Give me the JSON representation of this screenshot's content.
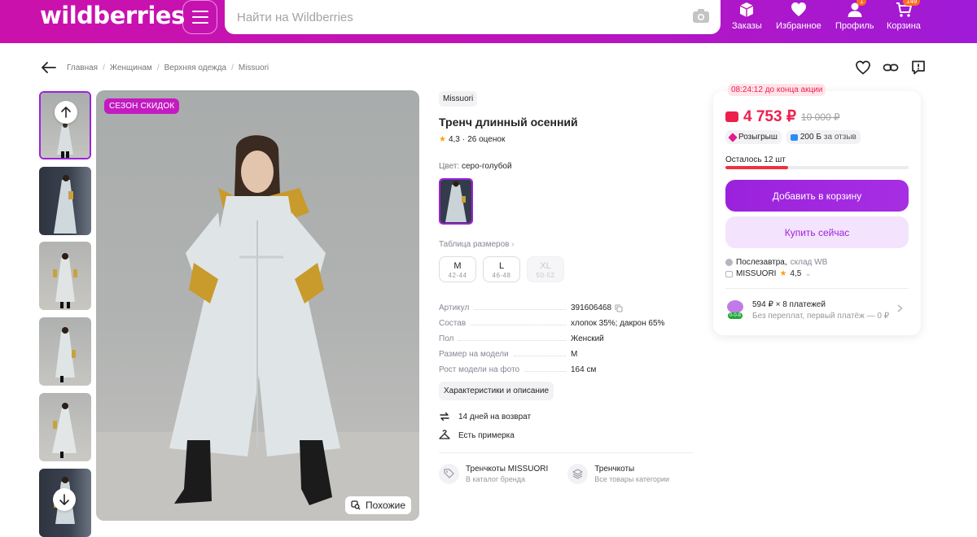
{
  "header": {
    "logo": "wildberries",
    "search_placeholder": "Найти на Wildberries",
    "nav": [
      {
        "label": "Заказы",
        "icon": "box-icon",
        "badge": ""
      },
      {
        "label": "Избранное",
        "icon": "heart-icon",
        "badge": ""
      },
      {
        "label": "Профиль",
        "icon": "user-icon",
        "badge": "1"
      },
      {
        "label": "Корзина",
        "icon": "cart-icon",
        "badge": "149"
      }
    ]
  },
  "breadcrumbs": [
    "Главная",
    "Женщинам",
    "Верхняя одежда",
    "Missuori"
  ],
  "gallery": {
    "sale_tag": "СЕЗОН СКИДОК",
    "similar_label": "Похожие"
  },
  "product": {
    "brand": "Missuori",
    "title": "Тренч длинный осенний",
    "rating": "4,3",
    "reviews": "26 оценок",
    "color_label": "Цвет:",
    "color_value": "серо-голубой",
    "size_table_link": "Таблица размеров",
    "sizes": [
      {
        "size": "M",
        "range": "42-44",
        "available": true
      },
      {
        "size": "L",
        "range": "46-48",
        "available": true
      },
      {
        "size": "XL",
        "range": "50-52",
        "available": false
      }
    ],
    "specs": [
      {
        "key": "Артикул",
        "value": "391606468"
      },
      {
        "key": "Состав",
        "value": "хлопок 35%; дакрон 65%"
      },
      {
        "key": "Пол",
        "value": "Женский"
      },
      {
        "key": "Размер на модели",
        "value": "M"
      },
      {
        "key": "Рост модели на фото",
        "value": "164 см"
      }
    ],
    "details_button": "Характеристики и описание",
    "features": [
      "14 дней на возврат",
      "Есть примерка"
    ],
    "categories": [
      {
        "title": "Тренчкоты MISSUORI",
        "subtitle": "В каталог бренда"
      },
      {
        "title": "Тренчкоты",
        "subtitle": "Все товары категории"
      }
    ]
  },
  "buy_box": {
    "timer": "08:24:12 до конца акции",
    "price": "4 753 ₽",
    "old_price": "10 000 ₽",
    "chip_raffle": "Розыгрыш",
    "chip_review": "200 Б",
    "chip_review_suffix": "за отзыв",
    "stock_label": "Осталось 12 шт",
    "stock_fraction": 0.34,
    "add_to_cart": "Добавить в корзину",
    "buy_now": "Купить сейчас",
    "delivery": "Послезавтра,",
    "delivery_sub": "склад WB",
    "seller": "MISSUORI",
    "seller_rating": "4,5",
    "installment_title": "594 ₽ × 8 платежей",
    "installment_sub": "Без переплат, первый платёж — 0 ₽",
    "installment_badge": "0-0-8"
  },
  "colors": {
    "accent": "#9b22dc",
    "price": "#ed1f4d",
    "header_start": "#cb11ab",
    "header_end": "#9f1bd7"
  }
}
